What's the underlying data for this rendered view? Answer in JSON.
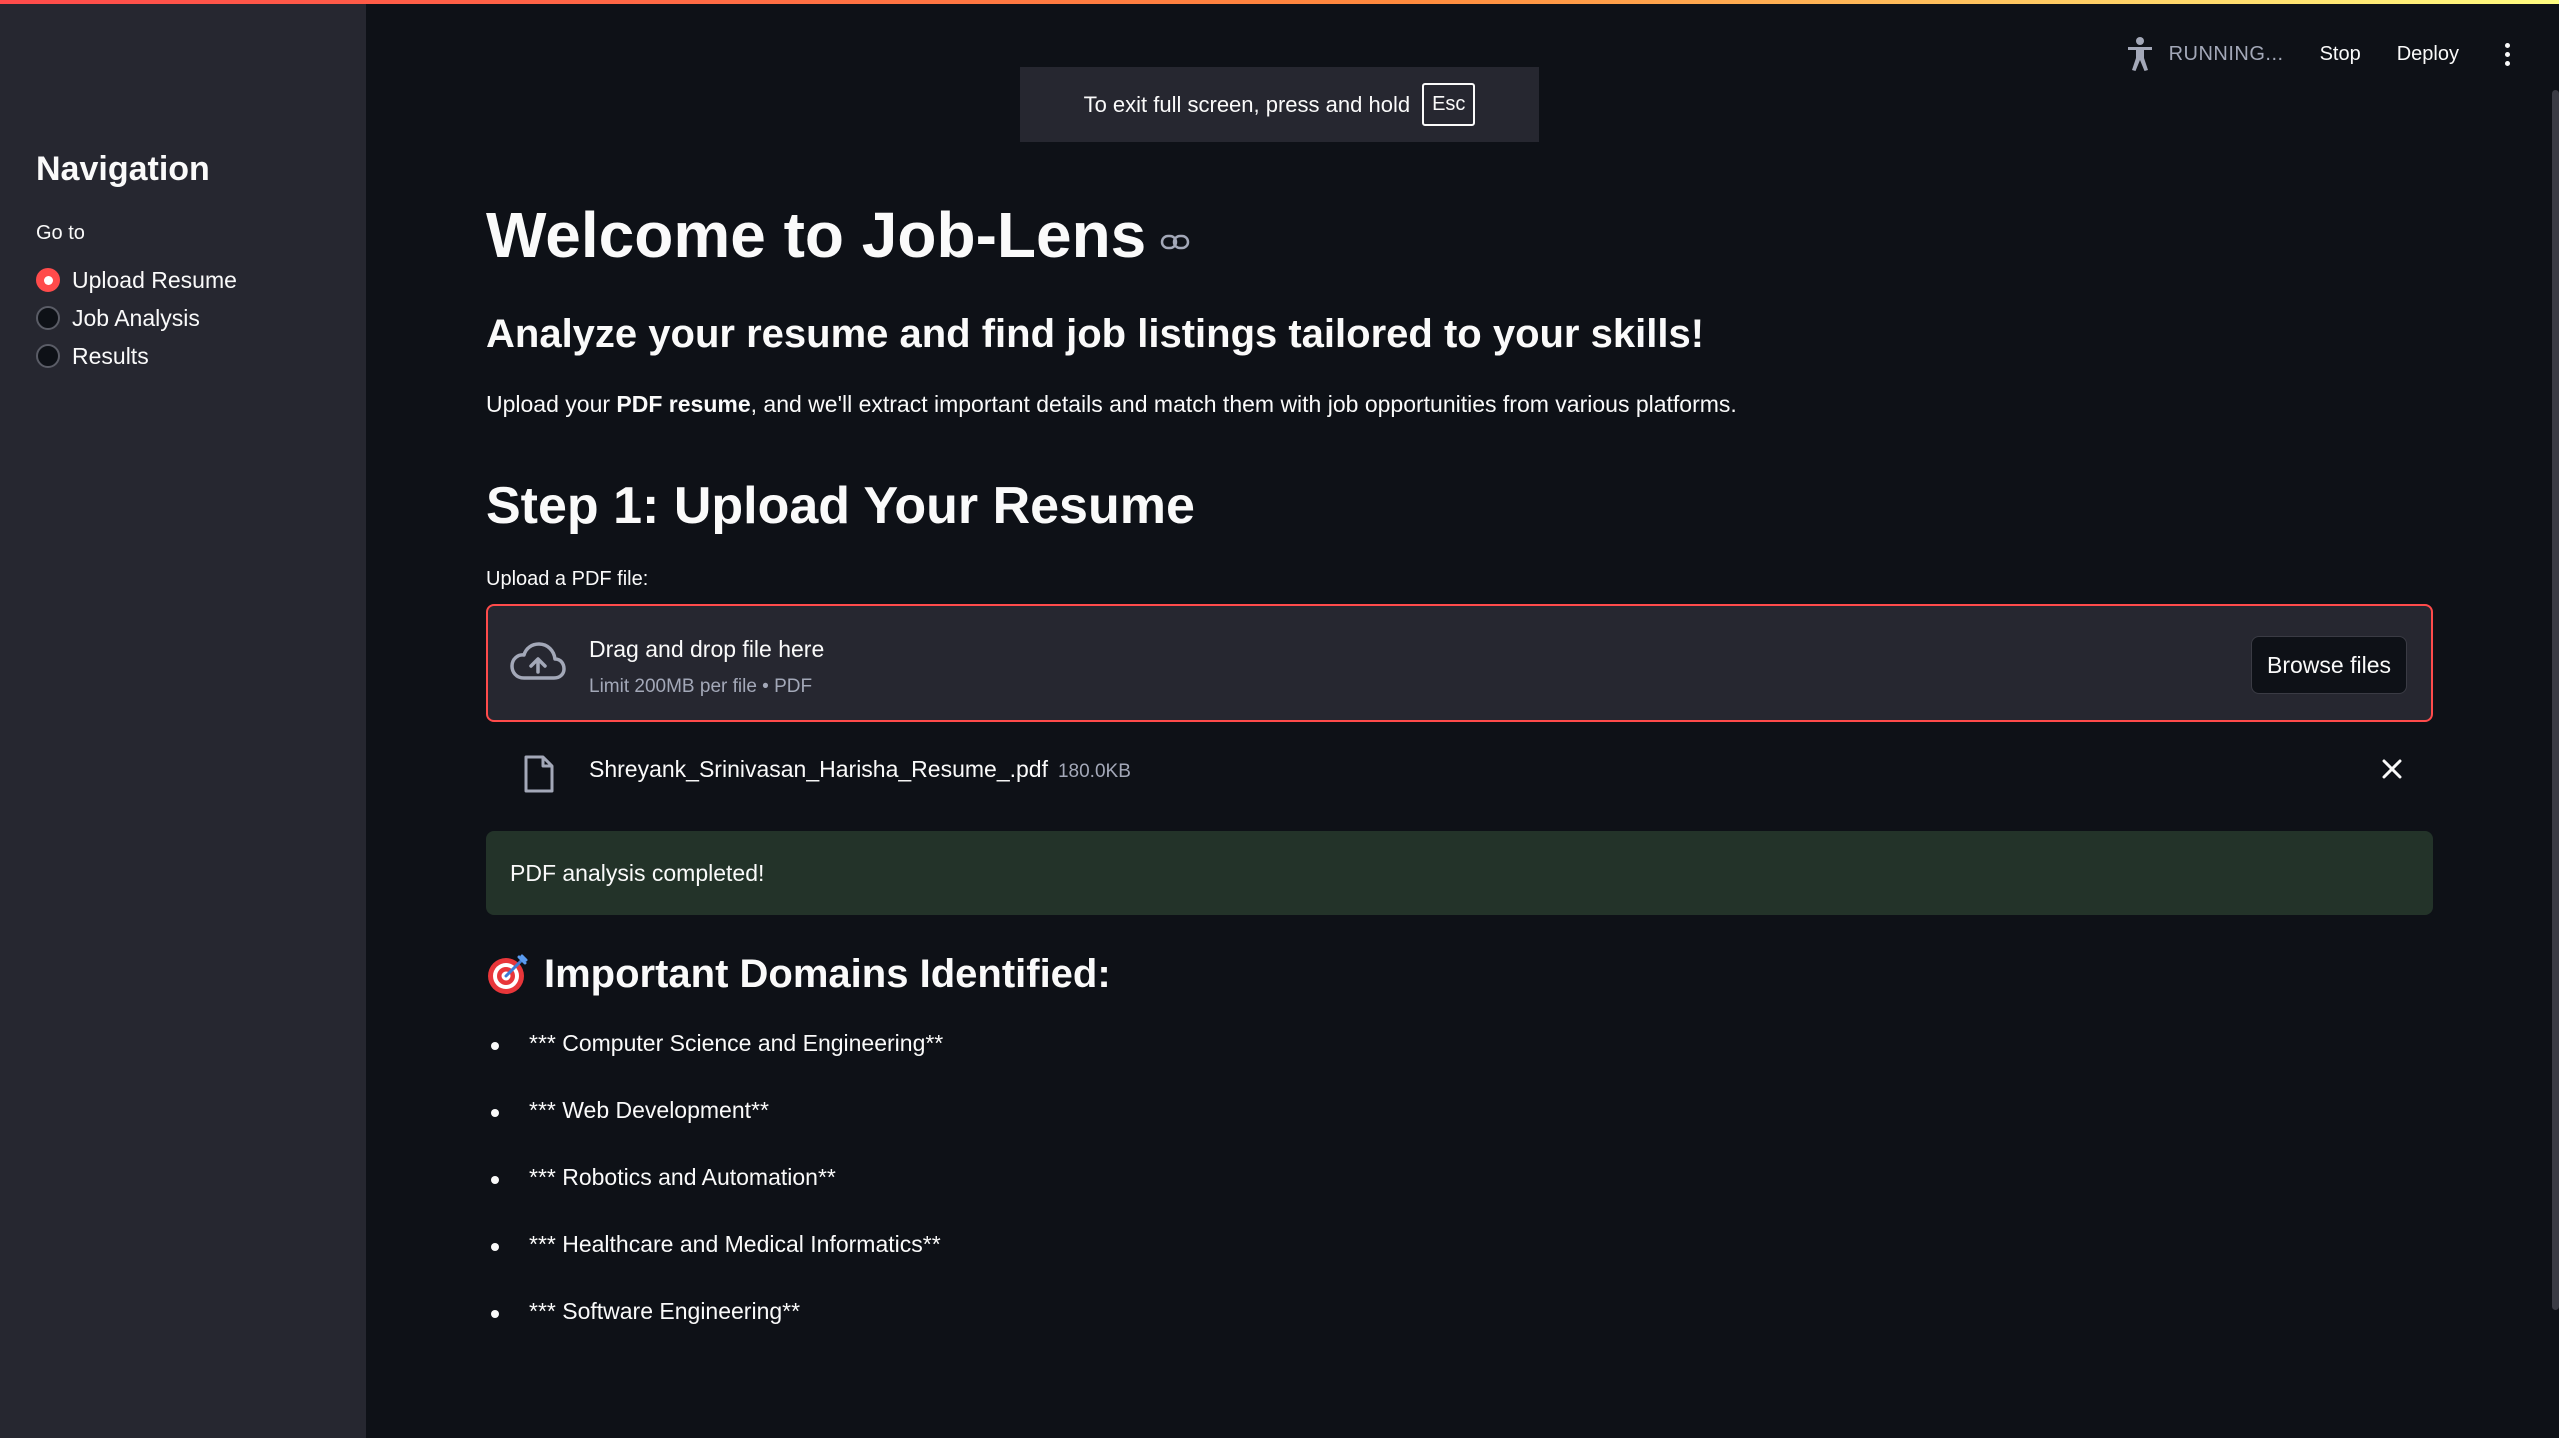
{
  "sidebar": {
    "title": "Navigation",
    "goto_label": "Go to",
    "options": [
      {
        "label": "Upload Resume",
        "selected": true
      },
      {
        "label": "Job Analysis",
        "selected": false
      },
      {
        "label": "Results",
        "selected": false
      }
    ]
  },
  "toolbar": {
    "status": "RUNNING...",
    "stop": "Stop",
    "deploy": "Deploy",
    "status_icon": "running-man-icon",
    "menu_icon": "kebab-menu-icon"
  },
  "fullscreen_toast": {
    "text": "To exit full screen, press and hold",
    "key": "Esc"
  },
  "main": {
    "title": "Welcome to Job-Lens",
    "subtitle": "Analyze your resume and find job listings tailored to your skills!",
    "intro_prefix": "Upload your ",
    "intro_bold": "PDF resume",
    "intro_suffix": ", and we'll extract important details and match them with job opportunities from various platforms.",
    "step_heading": "Step 1: Upload Your Resume",
    "uploader": {
      "label": "Upload a PDF file:",
      "drop_title": "Drag and drop file here",
      "limit": "Limit 200MB per file • PDF",
      "browse": "Browse files"
    },
    "file": {
      "name": "Shreyank_Srinivasan_Harisha_Resume_.pdf",
      "size": "180.0KB"
    },
    "success": "PDF analysis completed!",
    "domains_heading": "Important Domains Identified:",
    "domains": [
      "*** Computer Science and Engineering**",
      "*** Web Development**",
      "*** Robotics and Automation**",
      "*** Healthcare and Medical Informatics**",
      "*** Software Engineering**"
    ]
  },
  "colors": {
    "accent": "#ff4b4b",
    "background": "#0e1117",
    "sidebar": "#262730",
    "success_bg": "#233329"
  }
}
